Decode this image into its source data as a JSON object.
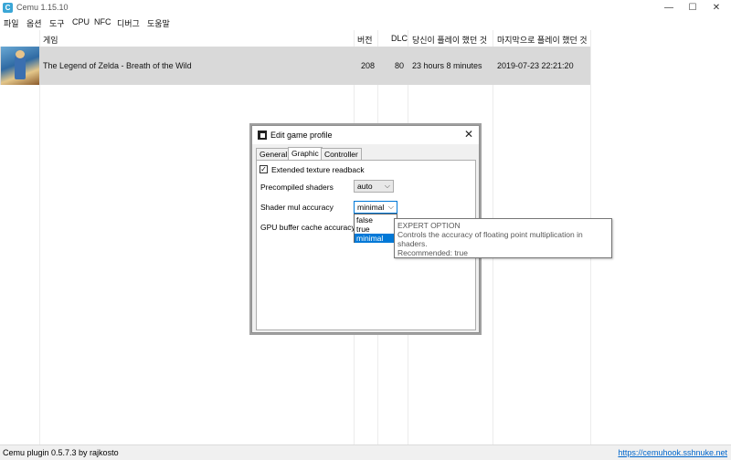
{
  "window": {
    "title": "Cemu 1.15.10",
    "icon_letter": "C",
    "minimize": "—",
    "maximize": "☐",
    "close": "✕"
  },
  "menu": [
    "파일",
    "옵션",
    "도구",
    "CPU",
    "NFC",
    "디버그",
    "도움말"
  ],
  "list": {
    "headers": {
      "game": "게임",
      "version": "버전",
      "dlc": "DLC",
      "playtime": "당신이 플레이 했던 것",
      "last_played": "마지막으로 플레이 했던 것"
    },
    "rows": [
      {
        "name": "The Legend of Zelda - Breath of the Wild",
        "version": "208",
        "dlc": "80",
        "playtime": "23 hours 8 minutes",
        "last_played": "2019-07-23 22:21:20"
      }
    ]
  },
  "dialog": {
    "title": "Edit game profile",
    "close": "✕",
    "tabs": [
      "General",
      "Graphic",
      "Controller"
    ],
    "active_tab": "Graphic",
    "extended_texture_readback": {
      "label": "Extended texture readback",
      "checked": true,
      "mark": "✓"
    },
    "precompiled_shaders": {
      "label": "Precompiled shaders",
      "value": "auto"
    },
    "shader_mul_accuracy": {
      "label": "Shader mul accuracy",
      "value": "minimal",
      "options": [
        "false",
        "true",
        "minimal"
      ],
      "selected_option": "minimal"
    },
    "gpu_buffer_cache_accuracy": {
      "label": "GPU buffer cache accuracy"
    },
    "dropdown_arrow": "⌵"
  },
  "tooltip": {
    "heading": "EXPERT OPTION",
    "line1": "Controls the accuracy of floating point multiplication in shaders.",
    "line2": "Recommended: true"
  },
  "statusbar": {
    "left": "Cemu plugin 0.5.7.3 by rajkosto",
    "right": "https://cemuhook.sshnuke.net"
  },
  "colors": {
    "accent": "#0078d7",
    "app_icon": "#3aa6d6",
    "selected_row": "#d9d9d9",
    "link": "#0066cc"
  }
}
